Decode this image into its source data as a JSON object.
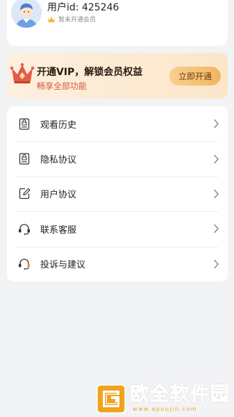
{
  "profile": {
    "user_id_text": "用户id: 425246",
    "vip_status": "暂未开通会员"
  },
  "vip_banner": {
    "title": "开通VIP，解锁会员权益",
    "subtitle": "畅享全部功能",
    "button_label": "立即开通",
    "accent_color": "#d4573a"
  },
  "menu": {
    "items": [
      {
        "label": "观看历史",
        "icon": "history-icon"
      },
      {
        "label": "隐私协议",
        "icon": "privacy-document-icon"
      },
      {
        "label": "用户协议",
        "icon": "edit-document-icon"
      },
      {
        "label": "联系客服",
        "icon": "headset-icon"
      },
      {
        "label": "投诉与建议",
        "icon": "feedback-headset-icon"
      }
    ]
  },
  "watermark": {
    "title": "欧全软件园",
    "url": "www.apoujin.com"
  }
}
